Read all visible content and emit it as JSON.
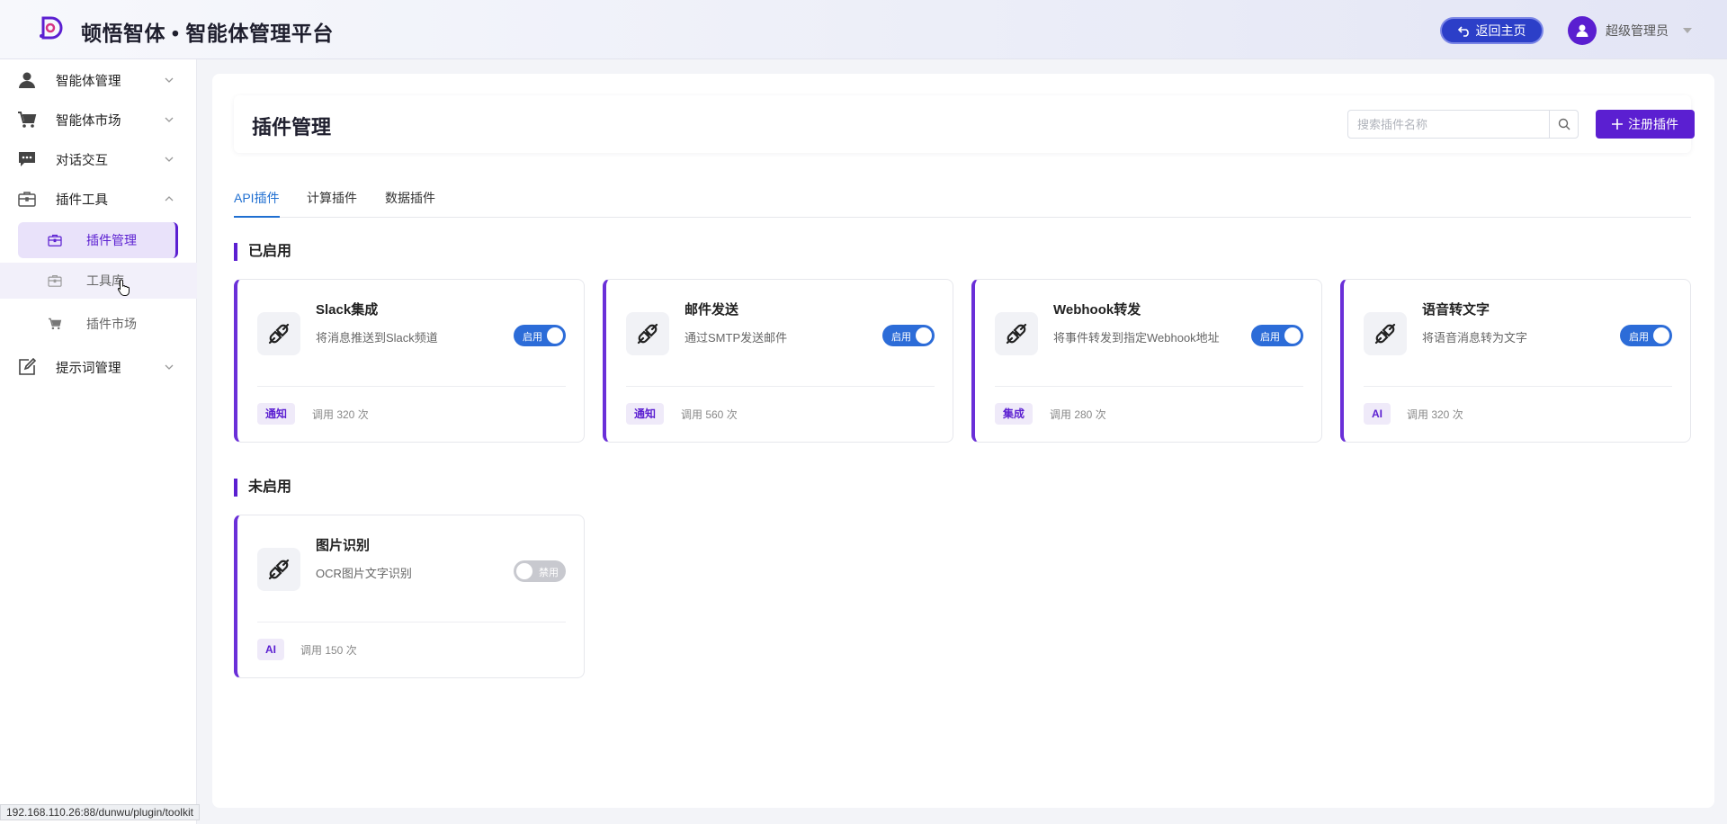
{
  "header": {
    "title": "顿悟智体 • 智能体管理平台",
    "home_button": "返回主页",
    "user_name": "超级管理员",
    "brand_color": "#5b1fd1"
  },
  "sidebar": {
    "items": [
      {
        "label": "智能体管理",
        "icon": "user-icon"
      },
      {
        "label": "智能体市场",
        "icon": "cart-icon"
      },
      {
        "label": "对话交互",
        "icon": "chat-icon"
      },
      {
        "label": "插件工具",
        "icon": "toolbox-icon",
        "expanded": true
      },
      {
        "label": "提示词管理",
        "icon": "edit-icon"
      }
    ],
    "sub_items": [
      {
        "label": "插件管理",
        "icon": "toolbox-icon",
        "active": true
      },
      {
        "label": "工具库",
        "icon": "toolbox-icon"
      },
      {
        "label": "插件市场",
        "icon": "cart-icon"
      }
    ]
  },
  "main": {
    "page_title": "插件管理",
    "search_placeholder": "搜索插件名称",
    "register_button": "注册插件",
    "tabs": [
      {
        "label": "API插件",
        "active": true
      },
      {
        "label": "计算插件"
      },
      {
        "label": "数据插件"
      }
    ],
    "enabled_section": "已启用",
    "disabled_section": "未启用",
    "enabled_plugins": [
      {
        "name": "Slack集成",
        "desc": "将消息推送到Slack频道",
        "toggle": "启用",
        "tag": "通知",
        "calls": "调用 320 次"
      },
      {
        "name": "邮件发送",
        "desc": "通过SMTP发送邮件",
        "toggle": "启用",
        "tag": "通知",
        "calls": "调用 560 次"
      },
      {
        "name": "Webhook转发",
        "desc": "将事件转发到指定Webhook地址",
        "toggle": "启用",
        "tag": "集成",
        "calls": "调用 280 次"
      },
      {
        "name": "语音转文字",
        "desc": "将语音消息转为文字",
        "toggle": "启用",
        "tag": "AI",
        "calls": "调用 320 次"
      }
    ],
    "disabled_plugins": [
      {
        "name": "图片识别",
        "desc": "OCR图片文字识别",
        "toggle": "禁用",
        "tag": "AI",
        "calls": "调用 150 次"
      }
    ]
  },
  "status_bar": {
    "url": "192.168.110.26:88/dunwu/plugin/toolkit"
  }
}
